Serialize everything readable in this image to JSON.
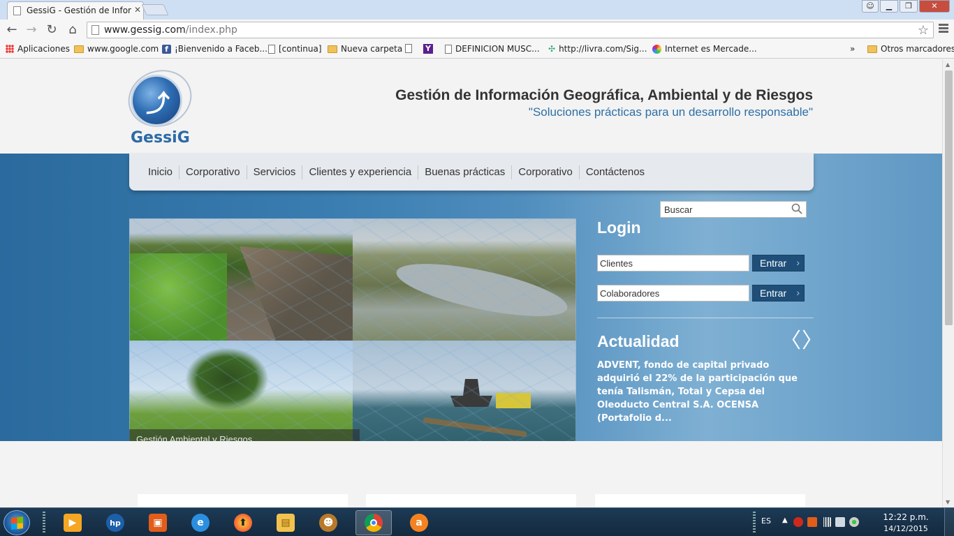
{
  "browser": {
    "tab_title": "GessiG - Gestión de Inform",
    "url_host": "www.gessig.com",
    "url_path": "/index.php",
    "window_controls": {
      "minimize": "▁",
      "restore": "❐",
      "close": "✕"
    },
    "bookmarks": [
      {
        "label": "Aplicaciones",
        "icon": "apps-grid-icon"
      },
      {
        "label": "www.google.com",
        "icon": "folder-icon"
      },
      {
        "label": "¡Bienvenido a Faceb...",
        "icon": "facebook-icon"
      },
      {
        "label": "[continua]",
        "icon": "page-icon"
      },
      {
        "label": "Nueva carpeta",
        "icon": "folder-icon"
      },
      {
        "label": "",
        "icon": "yahoo-icon"
      },
      {
        "label": "DEFINICION MUSC...",
        "icon": "page-icon"
      },
      {
        "label": "http://livra.com/Sig...",
        "icon": "livra-icon"
      },
      {
        "label": "Internet es Mercade...",
        "icon": "ball-icon"
      }
    ],
    "bookmarks_overflow": "»",
    "other_bookmarks": "Otros marcadores"
  },
  "site": {
    "logo_text": "GessiG",
    "title": "Gestión de Información Geográfica, Ambiental y de Riesgos",
    "tagline": "\"Soluciones prácticas para un desarrollo responsable\"",
    "nav": [
      "Inicio",
      "Corporativo",
      "Servicios",
      "Clientes y experiencia",
      "Buenas prácticas",
      "Corporativo",
      "Contáctenos"
    ],
    "search_placeholder": "Buscar",
    "slider_caption": "Gestión Ambiental y Riesgos",
    "login": {
      "title": "Login",
      "clients_placeholder": "Clientes",
      "collaborators_placeholder": "Colaboradores",
      "enter_label": "Entrar"
    },
    "news": {
      "title": "Actualidad",
      "text": "ADVENT, fondo de capital privado adquirió el 22% de la participación que tenía Talismán, Total y Cepsa del Oleoducto Central S.A. OCENSA (Portafolio d..."
    }
  },
  "taskbar": {
    "lang": "ES",
    "time": "12:22 p.m.",
    "date": "14/12/2015",
    "apps": [
      "media-player-icon",
      "hp-icon",
      "office-icon",
      "internet-explorer-icon",
      "update-icon",
      "file-explorer-icon",
      "game-icon",
      "chrome-icon",
      "avast-icon"
    ]
  }
}
